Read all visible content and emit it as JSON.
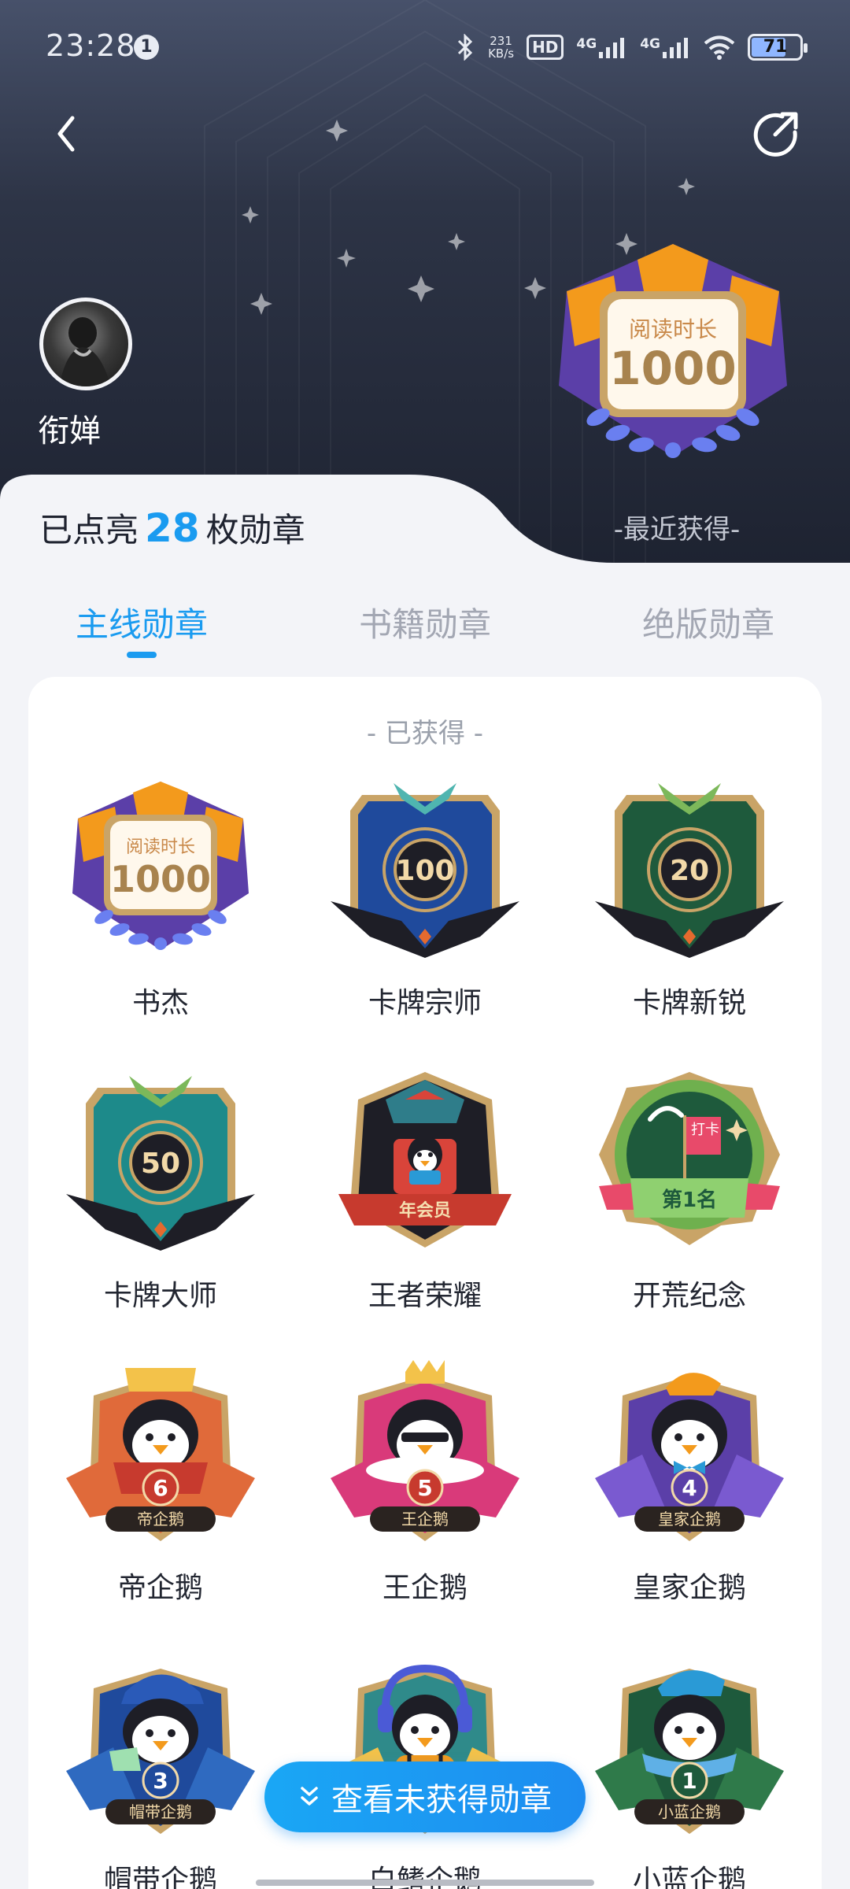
{
  "status_bar": {
    "time": "23:28",
    "notification_count": "1",
    "net_speed_value": "231",
    "net_speed_unit": "KB/s",
    "hd_label": "HD",
    "sim1_label": "4G",
    "sim2_label": "4G",
    "battery": "71"
  },
  "header": {
    "username": "衔婵",
    "lit_prefix": "已点亮",
    "lit_count": "28",
    "lit_suffix": "枚勋章",
    "recent_label": "-最近获得-",
    "recent_badge_text": "阅读时长",
    "recent_badge_number": "1000"
  },
  "tabs": [
    {
      "label": "主线勋章",
      "active": true
    },
    {
      "label": "书籍勋章",
      "active": false
    },
    {
      "label": "绝版勋章",
      "active": false
    }
  ],
  "section_title": "- 已获得 -",
  "badges": [
    {
      "name": "书杰",
      "icon": "reading-1000-badge",
      "label": "阅读时长",
      "number": "1000"
    },
    {
      "name": "卡牌宗师",
      "icon": "card-100-badge",
      "number": "100"
    },
    {
      "name": "卡牌新锐",
      "icon": "card-20-badge",
      "number": "20"
    },
    {
      "name": "卡牌大师",
      "icon": "card-50-badge",
      "number": "50"
    },
    {
      "name": "王者荣耀",
      "icon": "annual-member-badge",
      "label": "年会员"
    },
    {
      "name": "开荒纪念",
      "icon": "checkin-first-badge",
      "label": "第1名",
      "flag": "打卡"
    },
    {
      "name": "帝企鹅",
      "icon": "penguin-6-badge",
      "number": "6",
      "label": "帝企鹅"
    },
    {
      "name": "王企鹅",
      "icon": "penguin-5-badge",
      "number": "5",
      "label": "王企鹅"
    },
    {
      "name": "皇家企鹅",
      "icon": "penguin-4-badge",
      "number": "4",
      "label": "皇家企鹅"
    },
    {
      "name": "帽带企鹅",
      "icon": "penguin-3-badge",
      "number": "3",
      "label": "帽带企鹅"
    },
    {
      "name": "白鳍企鹅",
      "icon": "penguin-2-badge"
    },
    {
      "name": "小蓝企鹅",
      "icon": "penguin-1-badge",
      "number": "1",
      "label": "小蓝企鹅"
    }
  ],
  "float_button": "查看未获得勋章",
  "colors": {
    "accent": "#1a9bf0",
    "header_dark": "#1d2230",
    "gold": "#c9a467",
    "purple": "#5b3fa8"
  }
}
